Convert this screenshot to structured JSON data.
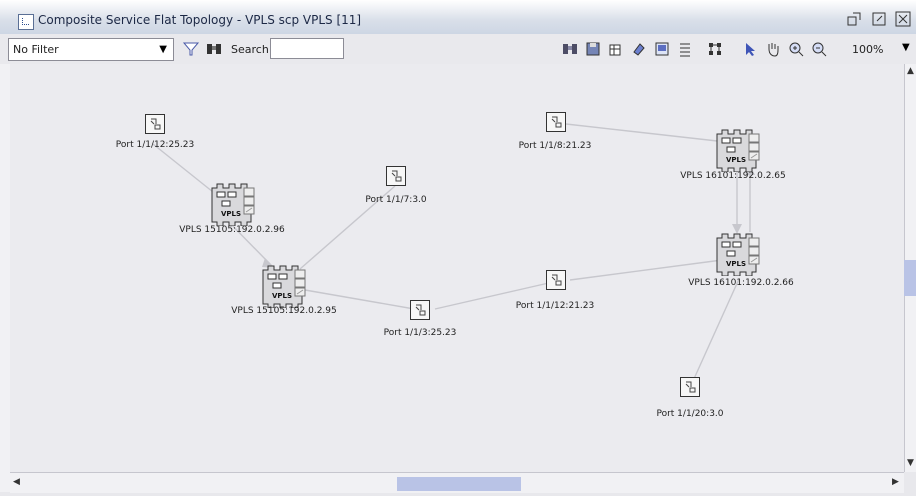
{
  "window": {
    "title": "Composite Service Flat Topology - VPLS scp VPLS [11]"
  },
  "toolbar": {
    "filter_value": "No Filter",
    "search_label": "Search",
    "search_value": "",
    "zoom_value": "100%"
  },
  "topology": {
    "ports": [
      {
        "label": "Port 1/1/12:25.23"
      },
      {
        "label": "Port 1/1/7:3.0"
      },
      {
        "label": "Port 1/1/3:25.23"
      },
      {
        "label": "Port 1/1/8:21.23"
      },
      {
        "label": "Port 1/1/12:21.23"
      },
      {
        "label": "Port 1/1/20:3.0"
      }
    ],
    "sites": [
      {
        "label": "VPLS 15105:192.0.2.96"
      },
      {
        "label": "VPLS 15105:192.0.2.95"
      },
      {
        "label": "VPLS 16101:192.0.2.65"
      },
      {
        "label": "VPLS 16101:192.0.2.66"
      }
    ],
    "site_badge": "VPLS"
  },
  "icons": [
    "window-icon",
    "restore-icon",
    "maximize-icon",
    "close-icon",
    "filter-icon",
    "binoculars-icon",
    "save-icon",
    "layout-icon",
    "refresh-icon",
    "map-icon",
    "list-icon",
    "tree-icon",
    "pointer-icon",
    "hand-icon",
    "zoom-in-icon",
    "zoom-out-icon"
  ]
}
